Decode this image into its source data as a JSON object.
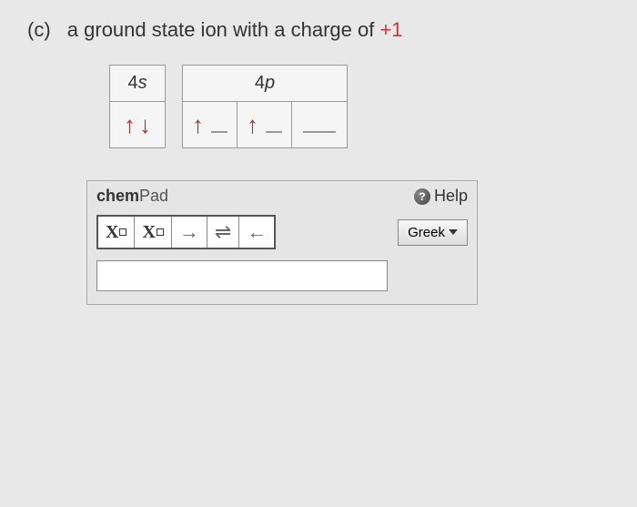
{
  "question": {
    "label": "(c)",
    "text_before": "a ground state ion with a charge of ",
    "charge": "+1"
  },
  "orbitals": {
    "s": {
      "label_num": "4",
      "label_letter": "s",
      "spins": [
        "↑",
        "↓"
      ]
    },
    "p": {
      "label_num": "4",
      "label_letter": "p",
      "boxes": [
        {
          "up": "↑",
          "hasSlot": true
        },
        {
          "up": "↑",
          "hasSlot": true
        },
        {
          "empty": true
        }
      ]
    }
  },
  "chempad": {
    "title_bold": "chem",
    "title_light": "Pad",
    "help_label": "Help",
    "tools": {
      "subscript": "X",
      "superscript": "X",
      "arrow_right": "→",
      "equilibrium": "⇌",
      "arrow_left": "←"
    },
    "greek_label": "Greek",
    "input_value": ""
  }
}
